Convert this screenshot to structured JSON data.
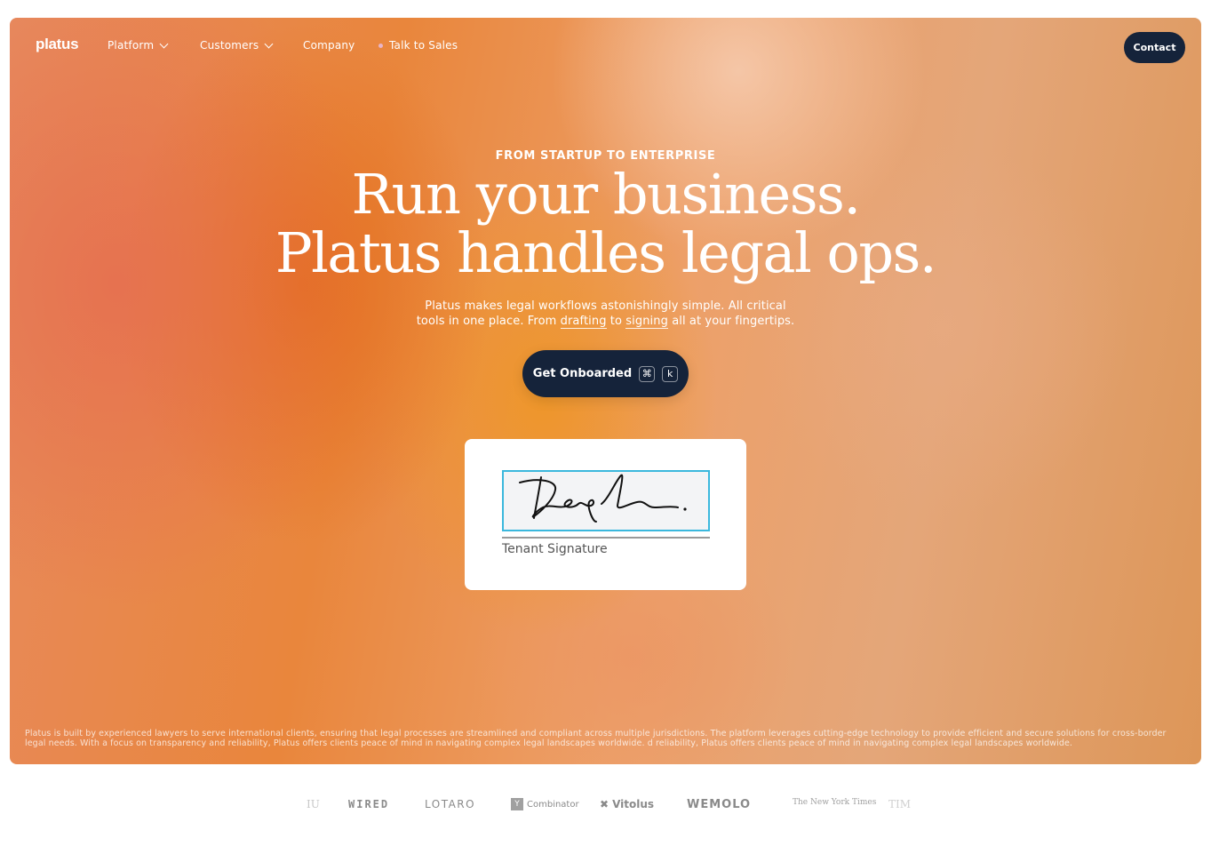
{
  "nav": {
    "logo": "platus",
    "items": [
      {
        "label": "Platform",
        "has_dropdown": true
      },
      {
        "label": "Customers",
        "has_dropdown": true
      },
      {
        "label": "Company",
        "has_dropdown": false
      },
      {
        "label": "Talk to Sales",
        "has_dropdown": false
      }
    ],
    "contact_label": "Contact"
  },
  "hero": {
    "eyebrow": "FROM STARTUP TO ENTERPRISE",
    "headline_line1": "Run your business.",
    "headline_line2": "Platus handles legal ops.",
    "sub_part1": "Platus makes legal workflows astonishingly simple. All critical",
    "sub_part2": "tools in one place. From ",
    "sub_link1": "drafting",
    "sub_mid": " to ",
    "sub_link2": "signing",
    "sub_part3": " all at your fingertips.",
    "cta_label": "Get Onboarded",
    "cta_shortcut_mod": "⌘",
    "cta_shortcut_key": "k"
  },
  "signature": {
    "label": "Tenant Signature"
  },
  "disclaimer": "Platus is built by experienced lawyers to serve international clients, ensuring that legal processes are streamlined and compliant across multiple jurisdictions. The platform leverages cutting-edge technology to provide efficient and secure solutions for cross-border legal needs. With a focus on transparency and reliability, Platus offers clients peace of mind in navigating complex legal landscapes worldwide. d reliability, Platus offers clients peace of mind in navigating complex legal landscapes worldwide.",
  "logos": {
    "partial_left": "IU",
    "wired": "WIRED",
    "lotaro": "LOTARO",
    "yc_mark": "Y",
    "yc_text": "Combinator",
    "vitolus": "Vitolus",
    "wemolo": "WEMOLO",
    "nyt": "The New York Times",
    "partial_right": "TIM"
  },
  "colors": {
    "navy": "#15233a",
    "signature_border": "#3bb8dd"
  }
}
